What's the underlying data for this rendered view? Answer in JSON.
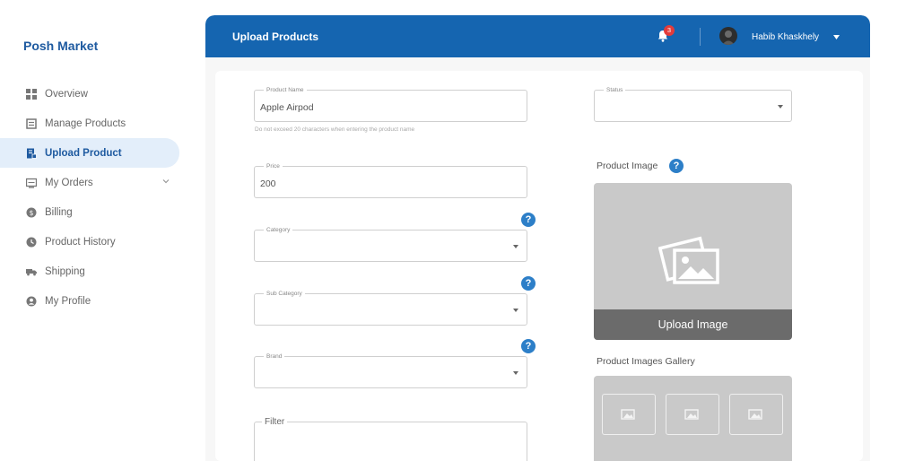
{
  "sidebar": {
    "brand": "Posh Market",
    "items": [
      {
        "label": "Overview",
        "icon": "grid-icon"
      },
      {
        "label": "Manage Products",
        "icon": "box-icon"
      },
      {
        "label": "Upload Product",
        "icon": "document-icon",
        "active": true
      },
      {
        "label": "My Orders",
        "icon": "orders-icon",
        "has_submenu": true
      },
      {
        "label": "Billing",
        "icon": "billing-icon"
      },
      {
        "label": "Product History",
        "icon": "history-icon"
      },
      {
        "label": "Shipping",
        "icon": "truck-icon"
      },
      {
        "label": "My Profile",
        "icon": "user-icon"
      }
    ]
  },
  "header": {
    "title": "Upload Products",
    "notification_count": "3",
    "user_name": "Habib Khaskhely"
  },
  "form": {
    "product_name": {
      "label": "Product Name",
      "value": "Apple Airpod",
      "helper": "Do not exceed 20 characters when entering the product name"
    },
    "price": {
      "label": "Price",
      "value": "200"
    },
    "category": {
      "label": "Category",
      "value": ""
    },
    "sub_category": {
      "label": "Sub Category",
      "value": ""
    },
    "brand": {
      "label": "Brand",
      "value": ""
    },
    "filter": {
      "label": "Filter"
    },
    "status": {
      "label": "Status",
      "value": ""
    }
  },
  "media": {
    "product_image_label": "Product Image",
    "upload_button": "Upload Image",
    "gallery_label": "Product Images Gallery"
  },
  "colors": {
    "primary": "#1565b0",
    "brand_text": "#1e5aa0",
    "help_icon": "#2d7fc8",
    "badge": "#e23b3b"
  }
}
